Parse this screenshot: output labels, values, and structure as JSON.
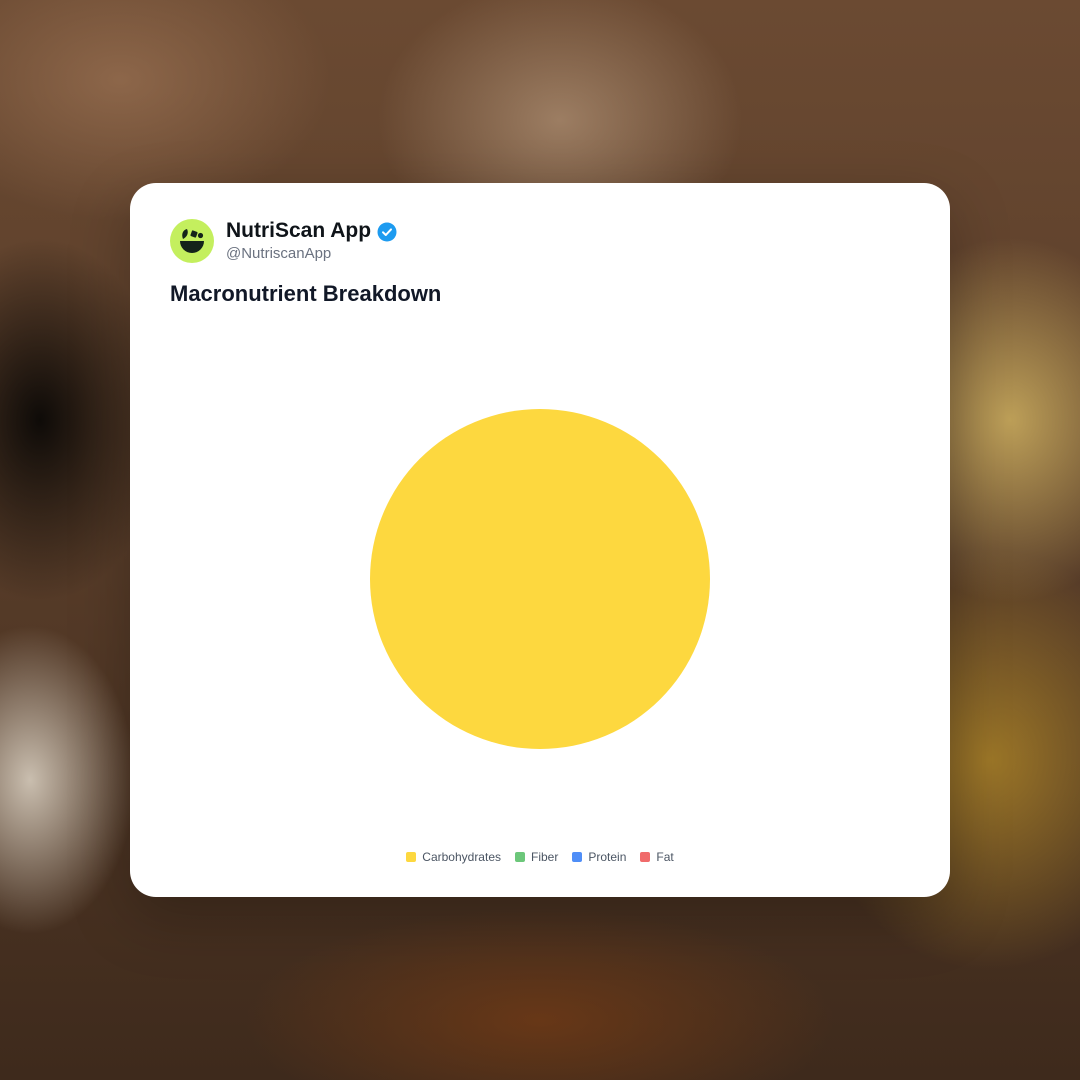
{
  "account": {
    "name": "NutriScan App",
    "handle": "@NutriscanApp",
    "verified": true,
    "avatar_icon": "nutriscan-logo-icon",
    "verified_icon": "verified-badge-icon"
  },
  "colors": {
    "avatar_bg": "#c4ef5e",
    "verified": "#1d9bf0",
    "carbohydrates": "#fdd83f",
    "fiber": "#6cc77a",
    "protein": "#4f8ef7",
    "fat": "#f06b6b"
  },
  "chart_data": {
    "type": "pie",
    "title": "Macronutrient Breakdown",
    "categories": [
      "Carbohydrates",
      "Fiber",
      "Protein",
      "Fat"
    ],
    "values": [
      100,
      0,
      0,
      0
    ],
    "colors": [
      "#fdd83f",
      "#6cc77a",
      "#4f8ef7",
      "#f06b6b"
    ],
    "legend": "bottom"
  }
}
